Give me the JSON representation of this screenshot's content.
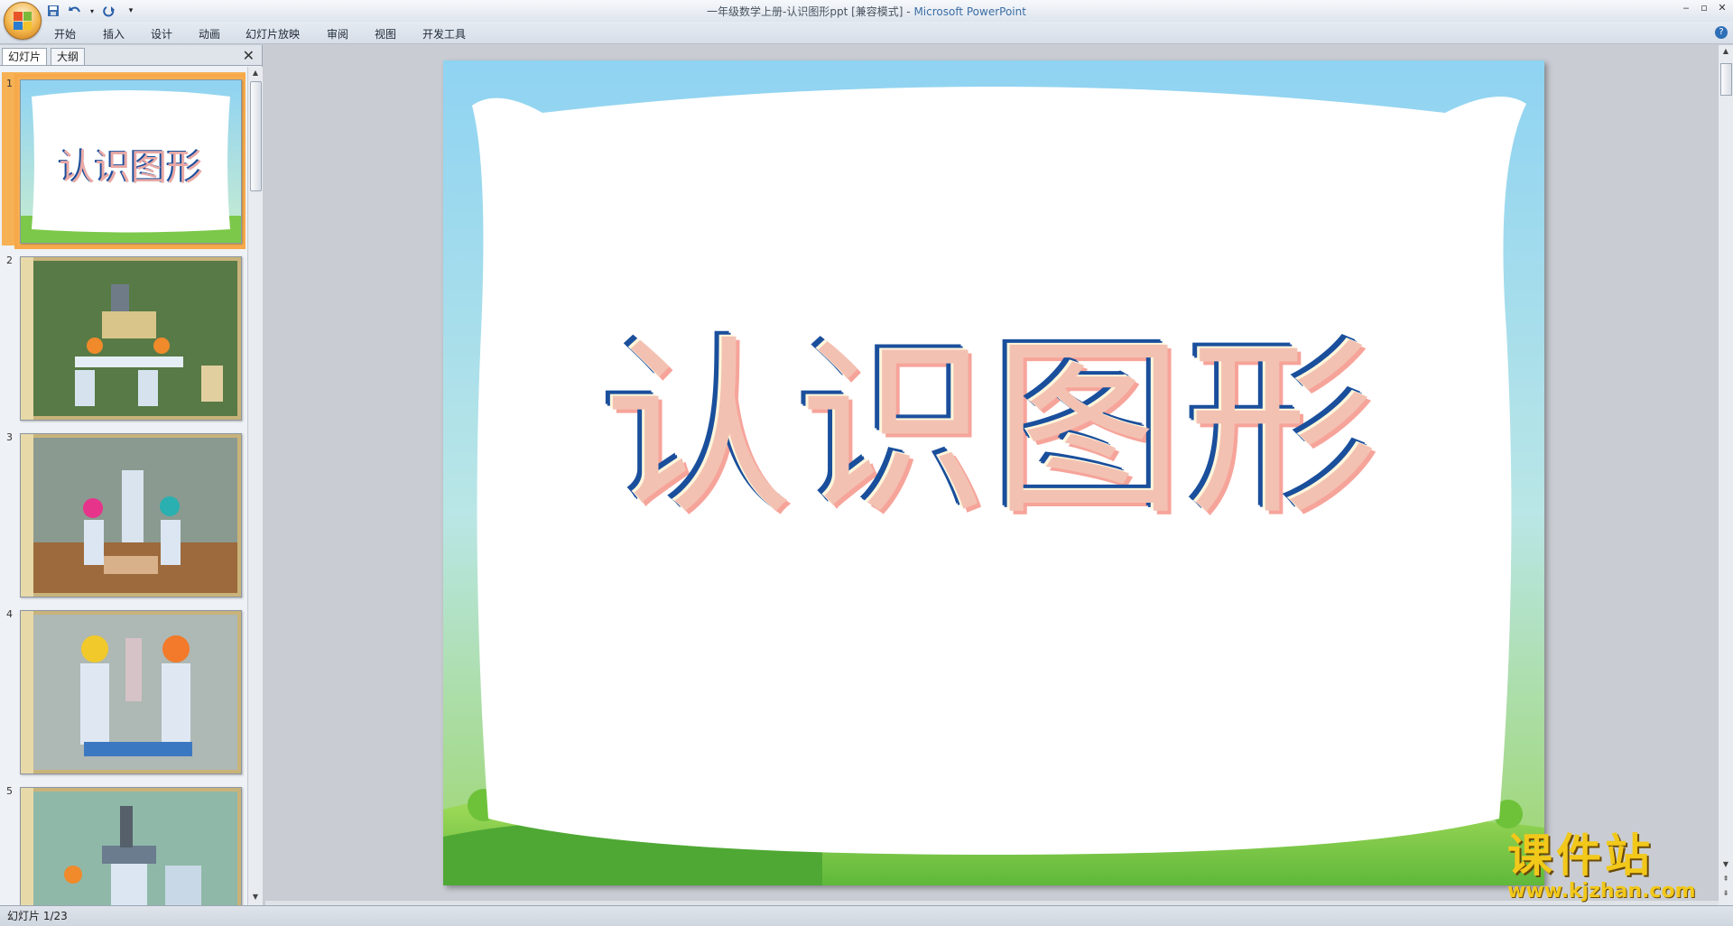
{
  "window": {
    "title_doc": "一年级数学上册-认识图形ppt [兼容模式]",
    "title_sep": " - ",
    "title_app": "Microsoft PowerPoint"
  },
  "ribbon": {
    "tabs": [
      "开始",
      "插入",
      "设计",
      "动画",
      "幻灯片放映",
      "审阅",
      "视图",
      "开发工具"
    ]
  },
  "panel": {
    "tabs": [
      "幻灯片",
      "大纲"
    ]
  },
  "thumbnails": [
    {
      "num": "1",
      "text": "认识图形"
    },
    {
      "num": "2",
      "text": ""
    },
    {
      "num": "3",
      "text": ""
    },
    {
      "num": "4",
      "text": ""
    },
    {
      "num": "5",
      "text": ""
    }
  ],
  "slide": {
    "title": "认识图形"
  },
  "status": {
    "slide_info": "幻灯片 1/23"
  },
  "watermark": {
    "line1": "课件站",
    "line2": "www.kjzhan.com"
  },
  "colors": {
    "selection": "#f6b154",
    "sky": "#8fd3f2",
    "grass": "#7cc84a",
    "title_blue": "#1a4f9c",
    "title_pink": "#f2a6a0"
  }
}
